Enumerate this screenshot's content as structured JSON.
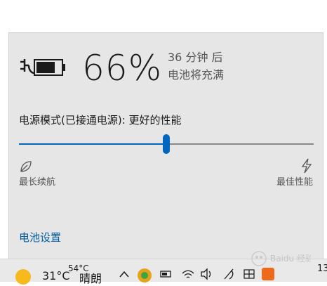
{
  "battery": {
    "percent": "66%",
    "time_remaining": "36 分钟 后",
    "charge_status": "电池将充满",
    "icon": "battery-charging-icon"
  },
  "power_mode": {
    "label": "电源模式(已接通电源): 更好的性能",
    "slider_level": 0.5,
    "min_label": "最长续航",
    "max_label": "最佳性能",
    "min_icon": "leaf-icon",
    "max_icon": "lightning-bolt-icon"
  },
  "settings_link": "电池设置",
  "taskbar": {
    "weather_temp": "31°C",
    "weather_small": "54°C",
    "weather_condition": "晴朗",
    "clock_partial": "13",
    "icons": [
      "sun-icon",
      "chevron-up-icon",
      "app-icon",
      "battery-icon",
      "wifi-icon",
      "volume-icon",
      "pen-icon",
      "ime-icon",
      "sogou-icon"
    ]
  },
  "watermark": "Baidu 经验",
  "colors": {
    "accent": "#0067c0",
    "link": "#005a9e",
    "flyout_bg": "#e6e6e6"
  }
}
